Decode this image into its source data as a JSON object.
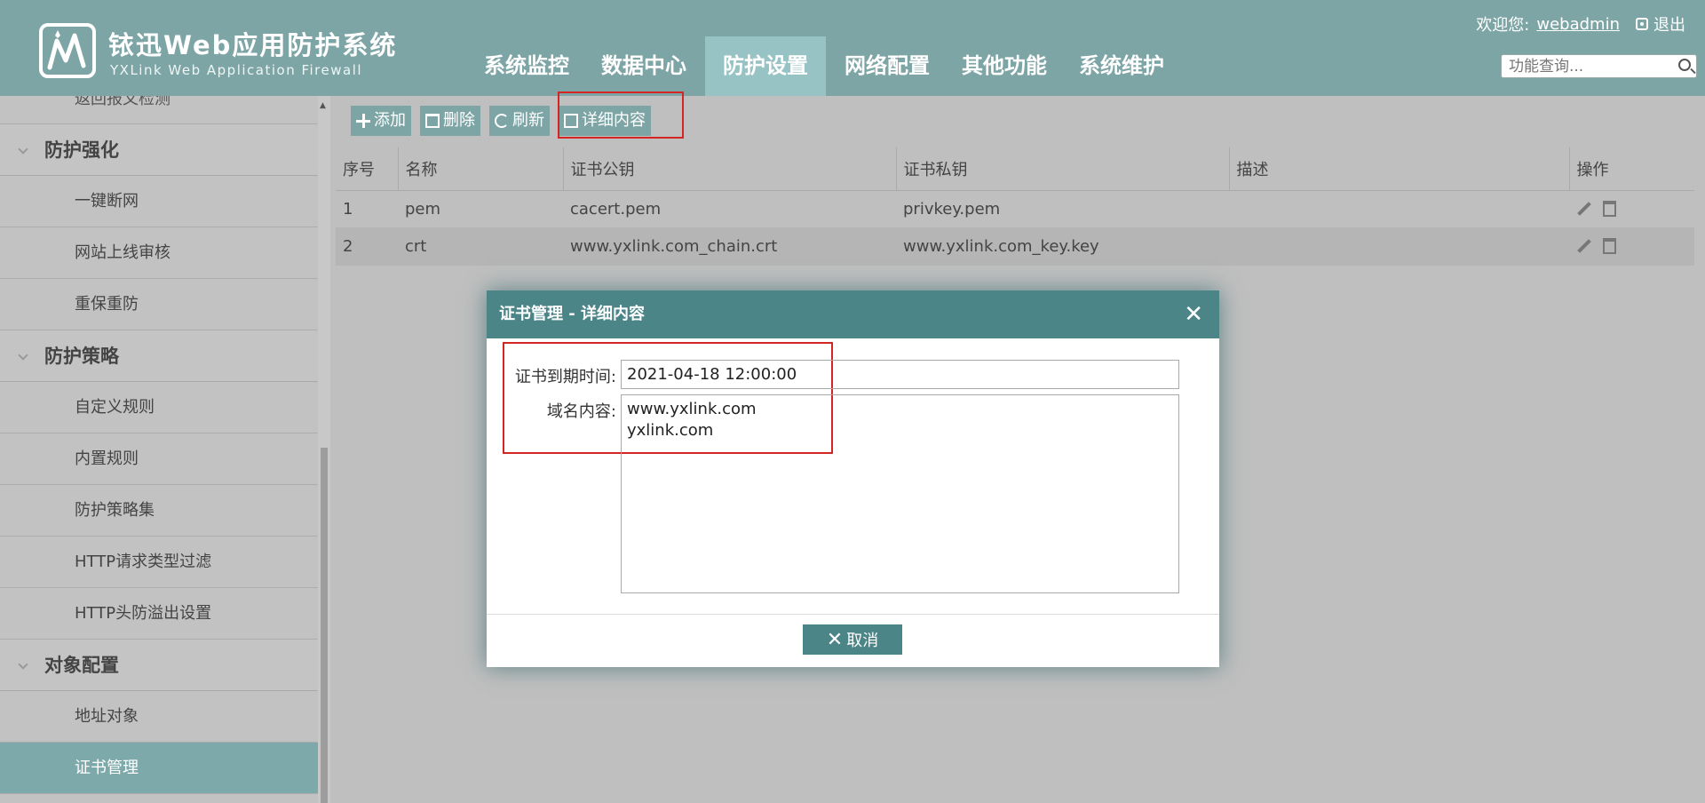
{
  "header": {
    "logo_cn": "铱迅Web应用防护系统",
    "logo_en": "YXLink Web Application Firewall",
    "welcome": "欢迎您:",
    "username": "webadmin",
    "logout": "退出",
    "search_placeholder": "功能查询...",
    "nav": [
      "系统监控",
      "数据中心",
      "防护设置",
      "网络配置",
      "其他功能",
      "系统维护"
    ],
    "nav_active": "防护设置"
  },
  "sidebar": {
    "partial_item": "返回报文检测",
    "groups": [
      {
        "title": "防护强化",
        "items": [
          "一键断网",
          "网站上线审核",
          "重保重防"
        ]
      },
      {
        "title": "防护策略",
        "items": [
          "自定义规则",
          "内置规则",
          "防护策略集",
          "HTTP请求类型过滤",
          "HTTP头防溢出设置"
        ]
      },
      {
        "title": "对象配置",
        "items": [
          "地址对象",
          "证书管理"
        ]
      }
    ],
    "active_item": "证书管理"
  },
  "toolbar": {
    "add": "添加",
    "delete": "删除",
    "refresh": "刷新",
    "detail": "详细内容"
  },
  "table": {
    "columns": [
      "序号",
      "名称",
      "证书公钥",
      "证书私钥",
      "描述",
      "操作"
    ],
    "rows": [
      {
        "no": "1",
        "name": "pem",
        "public_key": "cacert.pem",
        "private_key": "privkey.pem",
        "desc": ""
      },
      {
        "no": "2",
        "name": "crt",
        "public_key": "www.yxlink.com_chain.crt",
        "private_key": "www.yxlink.com_key.key",
        "desc": ""
      }
    ]
  },
  "modal": {
    "title": "证书管理 - 详细内容",
    "close": "✕",
    "expiry_label": "证书到期时间:",
    "expiry_value": "2021-04-18 12:00:00",
    "domain_label": "域名内容:",
    "domains": [
      "www.yxlink.com",
      "yxlink.com"
    ],
    "cancel": "取消"
  },
  "colors": {
    "header_bg": "#7ea5a6",
    "modal_accent": "#4b8588",
    "highlight": "#d52424"
  }
}
